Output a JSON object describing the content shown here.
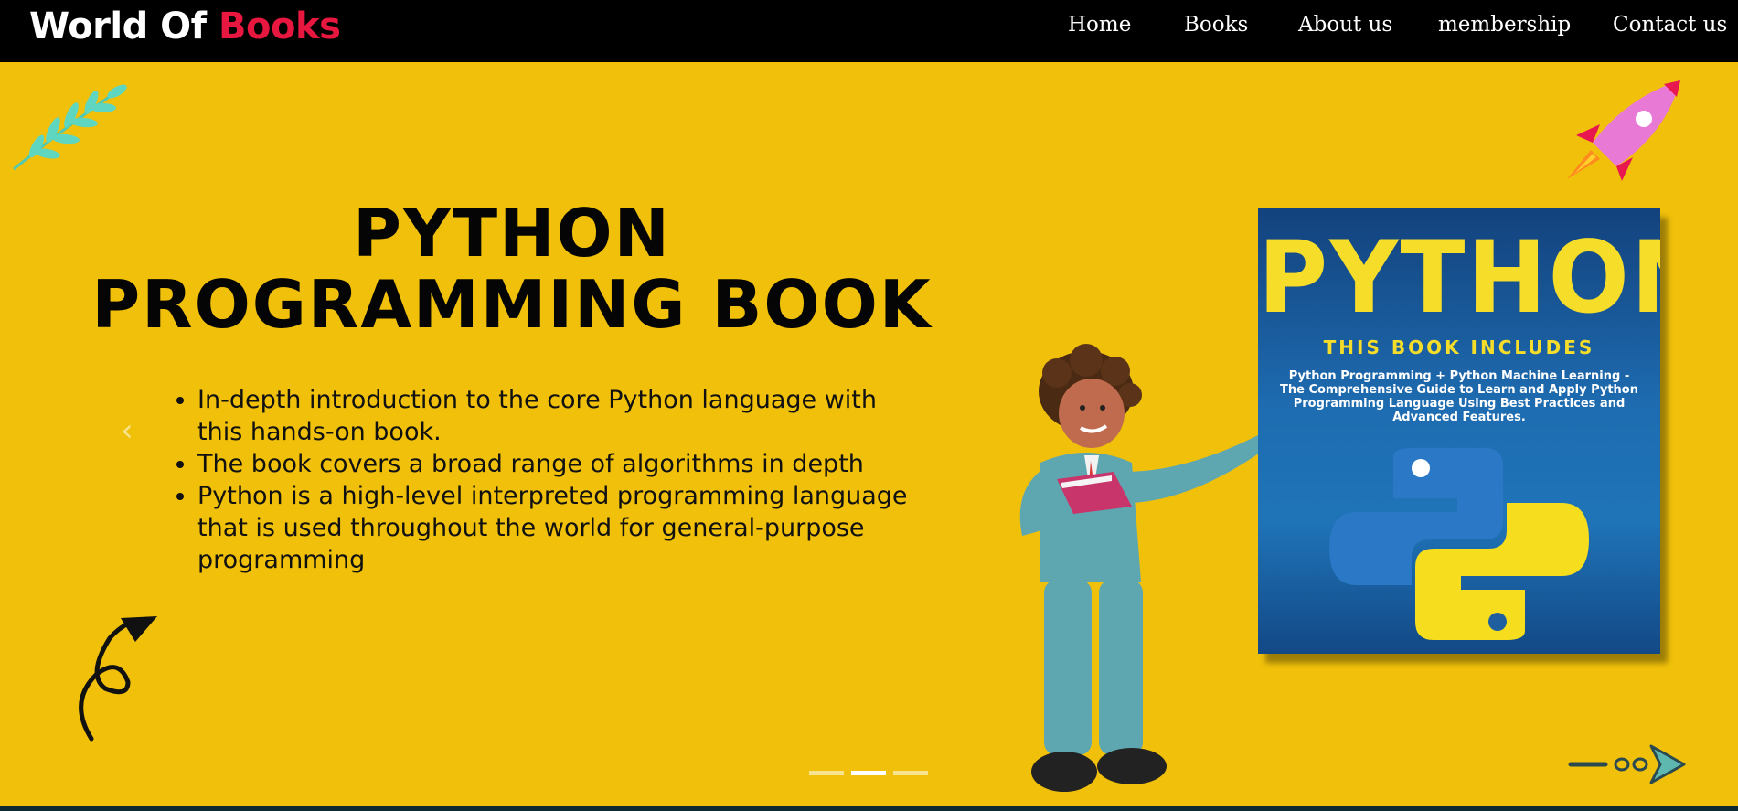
{
  "brand": {
    "part1": "World Of ",
    "part2": "Books",
    "accent_color": "#e8173f"
  },
  "nav": {
    "home": "Home",
    "books": "Books",
    "about": "About us",
    "membership": "membership",
    "contact": "Contact us"
  },
  "hero": {
    "title_line1": "PYTHON",
    "title_line2": "PROGRAMMING BOOK",
    "bullets": [
      "In-depth introduction to the core Python language with this hands-on book.",
      "The book covers a broad range of algorithms in depth",
      "Python is a high-level interpreted programming language that is used throughout the world for general-purpose programming"
    ],
    "background_color": "#f0c00a"
  },
  "carousel": {
    "prev_icon": "‹",
    "next_icon": "›",
    "active_index": 1,
    "slide_count": 3
  },
  "book_cover": {
    "title": "PYTHON",
    "subtitle": "THIS BOOK INCLUDES",
    "description": "Python Programming + Python Machine Learning - The Comprehensive Guide to Learn and Apply Python Programming Language Using Best Practices and Advanced Features."
  },
  "icons": {
    "leaf": "leaf-icon",
    "rocket": "rocket-icon",
    "curly_arrow": "curly-arrow-icon",
    "dashed_arrow": "dashed-arrow-icon",
    "python_logo": "python-logo-icon"
  }
}
